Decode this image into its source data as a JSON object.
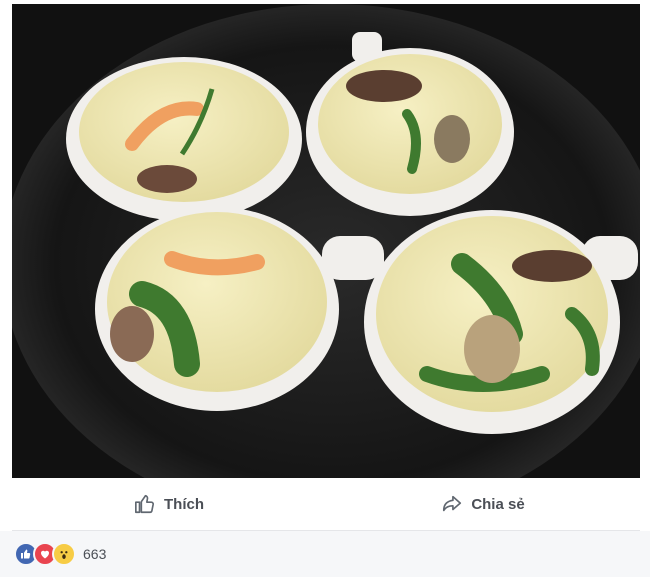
{
  "post": {
    "photo": {
      "subject": "four ramekins of steamed egg custard with shrimp, mushrooms and greens in a dark pot",
      "colors": {
        "pot": "#1c1c1c",
        "ramekin": "#f4f2ef",
        "custard": "#efe9b6",
        "shrimp": "#f0a060",
        "greens": "#3f7a2f",
        "mushroom": "#6b4a3a"
      }
    },
    "actions": {
      "like_icon": "thumbs-up-icon",
      "like_label": "Thích",
      "share_icon": "share-arrow-icon",
      "share_label": "Chia sẻ"
    },
    "reactions": {
      "icons": [
        "like-reaction-icon",
        "love-reaction-icon",
        "wow-reaction-icon"
      ],
      "count": "663"
    }
  },
  "colors": {
    "like_blue": "#4267b2",
    "love_red": "#e9444f",
    "wow_yellow": "#f7cc45",
    "text": "#4b4f56"
  }
}
